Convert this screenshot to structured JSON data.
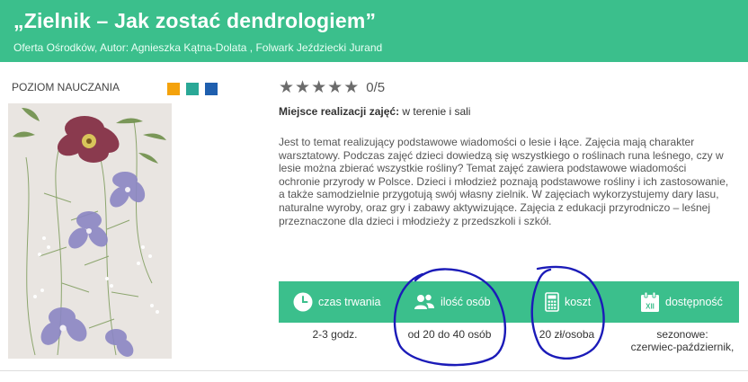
{
  "header": {
    "title": "„Zielnik – Jak zostać dendrologiem”",
    "subtitle": "Oferta Ośrodków, Autor: Agnieszka Kątna-Dolata , Folwark Jeździecki Jurand",
    "background": "#3bbf8c"
  },
  "level": {
    "label": "POZIOM NAUCZANIA",
    "colors": [
      "#f4a20c",
      "#2aa896",
      "#1f5fae"
    ]
  },
  "rating": {
    "stars_filled": 0,
    "stars_total": 5,
    "text": "0/5"
  },
  "place": {
    "label": "Miejsce realizacji zajęć:",
    "value": " w terenie i sali"
  },
  "description": [
    "Jest to temat realizujący podstawowe wiadomości o lesie i łące. Zajęcia mają charakter",
    "warsztatowy. Podczas zajęć dzieci dowiedzą się wszystkiego o roślinach runa leśnego, czy w",
    "lesie można zbierać wszystkie rośliny? Temat zajęć zawiera podstawowe wiadomości",
    "ochronie przyrody w Polsce. Dzieci i młodzież poznają podstawowe rośliny i ich zastosowanie,",
    "a także samodzielnie przygotują swój własny zielnik. W zajęciach wykorzystujemy dary lasu,",
    "naturalne wyroby, oraz gry i zabawy aktywizujące. Zajęcia z edukacji przyrodniczo – leśnej",
    "przeznaczone dla dzieci i młodzieży z przedszkoli i szkół."
  ],
  "info": {
    "duration": {
      "icon": "clock-icon",
      "label": "czas trwania",
      "value": "2-3 godz."
    },
    "people": {
      "icon": "people-icon",
      "label": "ilość osób",
      "value": "od 20 do 40 osób"
    },
    "cost": {
      "icon": "calculator-icon",
      "label": "koszt",
      "value": "20 zł/osoba"
    },
    "availability": {
      "icon": "calendar-icon",
      "calendar_text": "XII",
      "label": "dostępność",
      "value_line1": "sezonowe:",
      "value_line2": "czerwiec-październik,"
    }
  },
  "annotations": {
    "color": "#1b1bb8"
  }
}
